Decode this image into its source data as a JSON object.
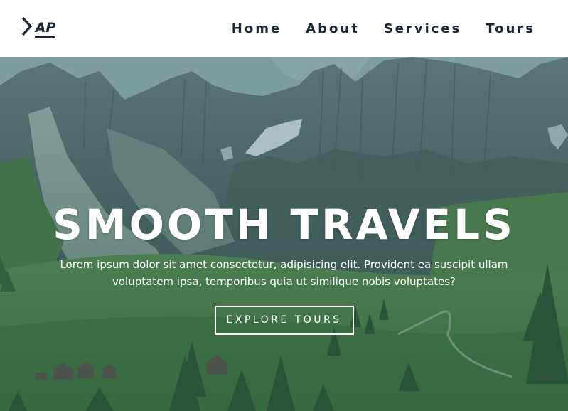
{
  "brand": {
    "logo_icon": "chevron-right-ap-monogram-icon",
    "logo_text": "AP",
    "logo_color": "#1d2738"
  },
  "nav": {
    "items": [
      {
        "label": "Home"
      },
      {
        "label": "About"
      },
      {
        "label": "Services"
      },
      {
        "label": "Tours"
      }
    ],
    "text_color": "#1d2738"
  },
  "hero": {
    "title": "SMOOTH TRAVELS",
    "text": "Lorem ipsum dolor sit amet consectetur, adipisicing elit. Provident ea suscipit ullam voluptatem ipsa, temporibus quia ut similique nobis voluptates?",
    "button_label": "EXPLORE TOURS",
    "background": "mountain-valley-photo",
    "overlay_color": "#265e60"
  }
}
